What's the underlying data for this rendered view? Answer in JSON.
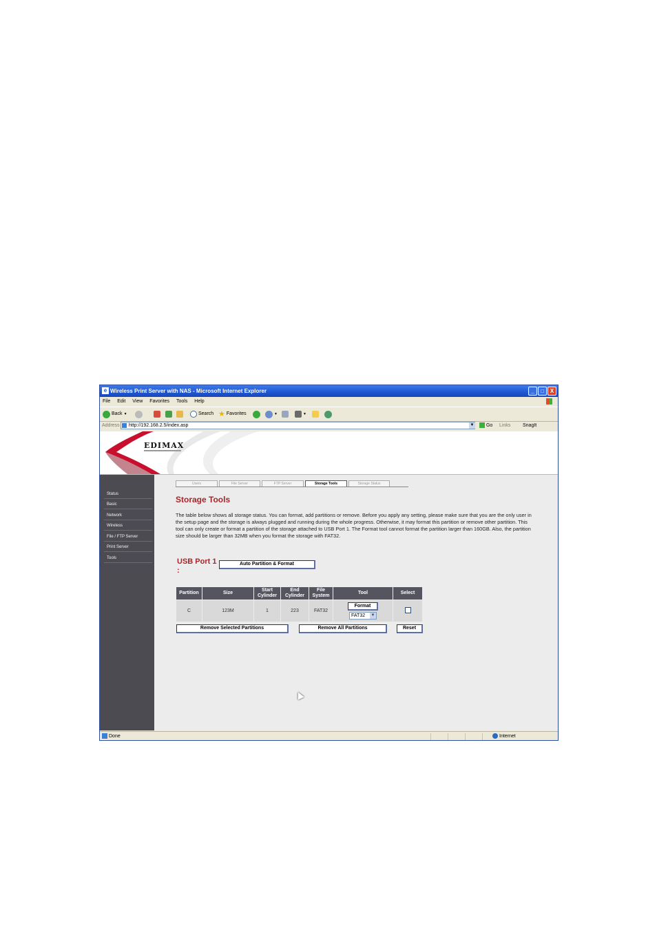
{
  "window": {
    "title": "Wireless Print Server with NAS - Microsoft Internet Explorer",
    "min_label": "_",
    "max_label": "□",
    "close_label": "X"
  },
  "menu": [
    "File",
    "Edit",
    "View",
    "Favorites",
    "Tools",
    "Help"
  ],
  "toolbar": {
    "back_label": "Back",
    "search_label": "Search",
    "favorites_label": "Favorites"
  },
  "address": {
    "label": "Address",
    "url": "http://192.168.2.5/index.asp",
    "go_label": "Go",
    "links_label": "Links",
    "snagit_label": "SnagIt"
  },
  "brand": {
    "logo_text": "EDIMAX"
  },
  "sidebar": {
    "items": [
      "Status",
      "Basic",
      "Network",
      "Wireless",
      "File / FTP Server",
      "Print Server",
      "Tools"
    ]
  },
  "tabs": [
    "Users",
    "File Server",
    "FTP Server",
    "Storage Tools",
    "Storage Status"
  ],
  "active_tab": "Storage Tools",
  "content": {
    "heading": "Storage Tools",
    "description": "The table below shows all storage status. You can format, add partitions or remove. Before you apply any setting, please make sure that you are the only user in the setup page and the storage is always plugged and running during the whole progress. Otherwise, it may format this partition or remove other partition. This tool can only create or format a partition of the storage attached to USB Port 1. The Format tool cannot format the partition larger than 160GB. Also, the partition size should be larger than 32MB when you format the storage with FAT32.",
    "usb_port_label": "USB Port 1 :",
    "auto_partition_button": "Auto Partition & Format"
  },
  "partition_table": {
    "headers": [
      "Partition",
      "Size",
      "Start Cylinder",
      "End Cylinder",
      "File System",
      "Tool",
      "Select"
    ],
    "rows": [
      {
        "partition": "C",
        "size": "123M",
        "start": "1",
        "end": "223",
        "fs": "FAT32",
        "format_label": "Format",
        "fs_option": "FAT32",
        "selected": false
      }
    ]
  },
  "actions": {
    "remove_selected": "Remove Selected Partitions",
    "remove_all": "Remove All Partitions",
    "reset": "Reset"
  },
  "status": {
    "left": "Done",
    "zone": "Internet"
  }
}
